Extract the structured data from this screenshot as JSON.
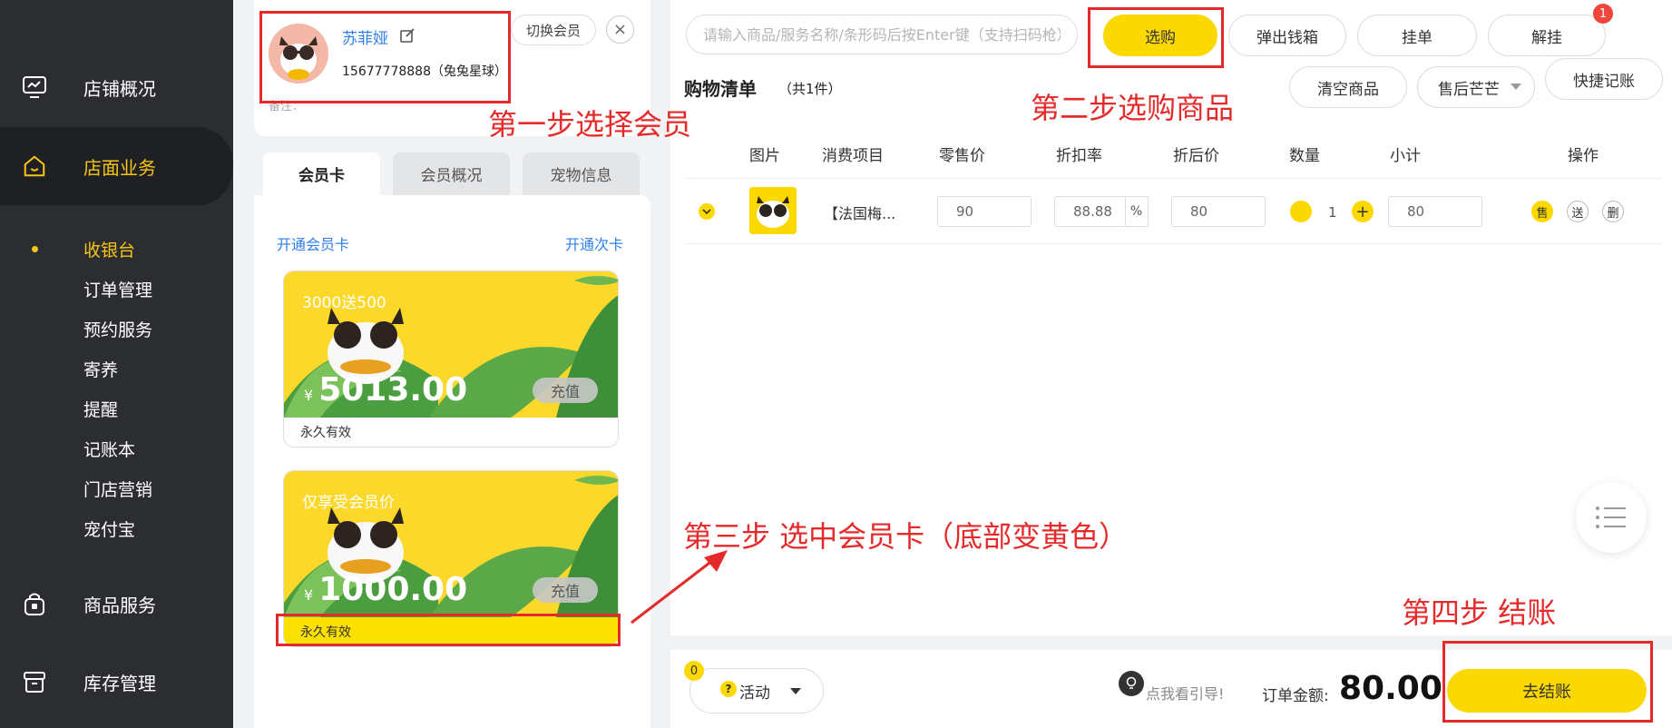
{
  "sidebar": {
    "items": [
      {
        "label": "店铺概况"
      },
      {
        "label": "店面业务"
      },
      {
        "label": "商品服务"
      },
      {
        "label": "库存管理"
      }
    ],
    "sub_items": [
      "收银台",
      "订单管理",
      "预约服务",
      "寄养",
      "提醒",
      "记账本",
      "门店营销",
      "宠付宝"
    ]
  },
  "member": {
    "name": "苏菲娅",
    "phone": "15677778888（兔兔星球）",
    "remark": "备注：",
    "switch_label": "切换会员",
    "close_symbol": "×"
  },
  "tabs": [
    "会员卡",
    "会员概况",
    "宠物信息"
  ],
  "cards_panel": {
    "open_card": "开通会员卡",
    "open_times": "开通次卡"
  },
  "cards": [
    {
      "name": "3000送500",
      "currency": "¥",
      "amount": "5013.00",
      "recharge": "充值",
      "validity": "永久有效",
      "selected": false
    },
    {
      "name": "仅享受会员价",
      "currency": "¥",
      "amount": "1000.00",
      "recharge": "充值",
      "validity": "永久有效",
      "selected": true
    }
  ],
  "toolbar": {
    "search_placeholder": "请输入商品/服务名称/条形码后按Enter键（支持扫码枪）",
    "buy": "选购",
    "cash_drawer": "弹出钱箱",
    "hold": "挂单",
    "unhold": "解挂",
    "unhold_badge": "1",
    "clear": "清空商品",
    "after_sales": "售后芒芒",
    "quick_book": "快捷记账"
  },
  "cart": {
    "title": "购物清单",
    "count": "（共1件）",
    "columns": [
      "图片",
      "消费项目",
      "零售价",
      "折扣率",
      "折后价",
      "数量",
      "小计",
      "操作"
    ],
    "row": {
      "name": "【法国梅...",
      "retail_price": "90",
      "discount": "88.88",
      "discount_unit": "%",
      "discounted_price": "80",
      "qty": "1",
      "subtotal": "80",
      "ops": [
        "售",
        "送",
        "删"
      ]
    }
  },
  "bottom": {
    "activity_badge": "0",
    "activity_q": "?",
    "activity": "活动",
    "guide": "点我看引导!",
    "order_label": "订单金额:",
    "order_amount": "80.00",
    "checkout": "去结账"
  },
  "annotations": {
    "step1": "第一步选择会员",
    "step2": "第二步选购商品",
    "step3": "第三步 选中会员卡（底部变黄色）",
    "step4": "第四步 结账"
  },
  "colors": {
    "accent": "#fbd800",
    "sidebar_bg": "#2b2d31",
    "link": "#2f7fe8",
    "annotation": "#e42a2a"
  }
}
